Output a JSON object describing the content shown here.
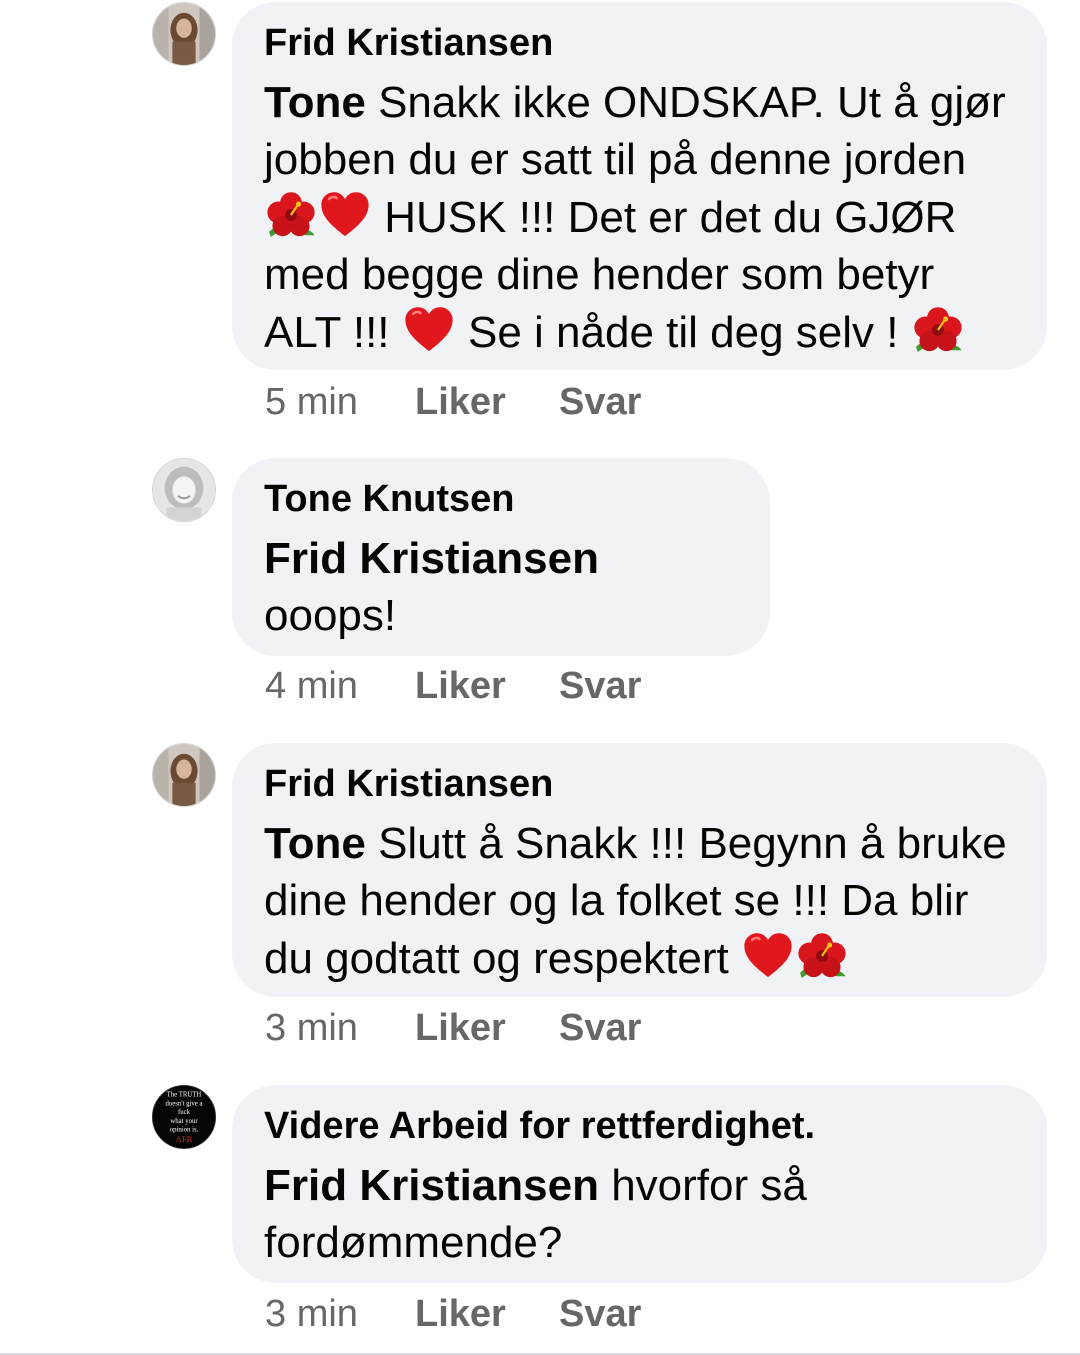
{
  "comments": [
    {
      "author": "Frid Kristiansen",
      "mention": "Tone",
      "text_1": " Snakk ikke ONDSKAP. Ut å gjør jobben du er satt til på denne jorden ",
      "text_2": " HUSK !!! Det er det du GJØR med begge dine hender som betyr ALT !!! ",
      "text_3": " Se i nåde til deg selv ! ",
      "emojis": [
        "hibiscus-icon",
        "heart-icon",
        "heart-icon",
        "hibiscus-icon"
      ],
      "time": "5 min",
      "like": "Liker",
      "reply": "Svar"
    },
    {
      "author": "Tone Knutsen",
      "mention": "Frid Kristiansen",
      "text_1": " ooops!",
      "time": "4 min",
      "like": "Liker",
      "reply": "Svar"
    },
    {
      "author": "Frid Kristiansen",
      "mention": "Tone",
      "text_1": " Slutt å Snakk !!! Begynn å bruke dine hender og la folket se !!! Da blir du godtatt og respektert ",
      "emojis": [
        "heart-icon",
        "hibiscus-icon"
      ],
      "time": "3 min",
      "like": "Liker",
      "reply": "Svar"
    },
    {
      "author": "Videre Arbeid for rettferdighet.",
      "mention": "Frid Kristiansen",
      "text_1": " hvorfor så fordømmende?",
      "avatar_text": [
        "The TRUTH",
        "doesn't give a",
        "fuck",
        "what your",
        "opinion is.",
        "AFR"
      ],
      "time": "3 min",
      "like": "Liker",
      "reply": "Svar"
    }
  ],
  "colors": {
    "bubble": "#f0f2f5",
    "meta_text": "#65676b",
    "text": "#050505",
    "heart": "#e0171c",
    "hibiscus": "#d8161b"
  }
}
